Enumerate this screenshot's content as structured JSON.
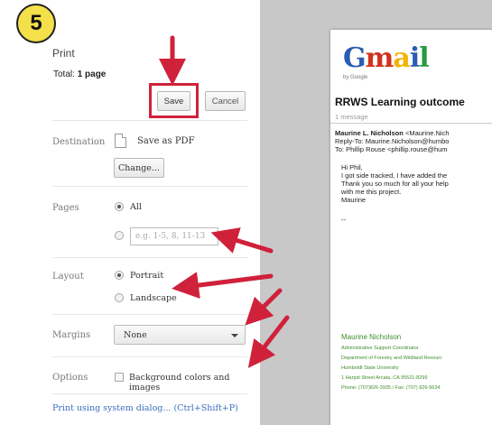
{
  "step_badge": "5",
  "panel": {
    "title": "Print",
    "total_label": "Total:",
    "total_value": "1 page",
    "save_label": "Save",
    "cancel_label": "Cancel",
    "destination": {
      "label": "Destination",
      "name": "Save as PDF",
      "change_label": "Change..."
    },
    "pages": {
      "label": "Pages",
      "all_label": "All",
      "selected": "All",
      "range_placeholder": "e.g. 1-5, 8, 11-13"
    },
    "layout": {
      "label": "Layout",
      "portrait_label": "Portrait",
      "landscape_label": "Landscape",
      "selected": "Portrait"
    },
    "margins": {
      "label": "Margins",
      "value": "None"
    },
    "options": {
      "label": "Options",
      "background_label": "Background colors and images",
      "background_checked": false
    },
    "system_dialog_link": "Print using system dialog... (Ctrl+Shift+P)"
  },
  "preview": {
    "logo_text": "Gmail",
    "logo_sub": "by Google",
    "subject": "RRWS Learning outcome",
    "message_count": "1 message",
    "from_name": "Maurine L. Nicholson",
    "from_email": "<Maurine.Nich",
    "reply_to": "Reply-To: Maurine.Nicholson@humbo",
    "to": "To: Phillip Rouse <phillip.rouse@hum",
    "body_lines": [
      "Hi Phil,",
      "I got side tracked, I have added the",
      "Thank you so much for all your help",
      "with me this project.",
      "Maurine"
    ],
    "separator": "--",
    "signature": {
      "name": "Maurine Nicholson",
      "lines": [
        "Administrative Support Coordinator",
        "Department of Forestry and Wildland Resourc",
        "Humboldt State University",
        "1 Harpst Street Arcata, CA 95521-8299",
        "Phone: (707)826-3935 / Fax: (707) 826-5634"
      ]
    }
  },
  "colors": {
    "annotation_red": "#d0213b",
    "badge_yellow": "#f4e04a",
    "link_blue": "#3a6ebf",
    "signature_green": "#3f8f2a",
    "preview_gray": "#c8c8c8"
  }
}
